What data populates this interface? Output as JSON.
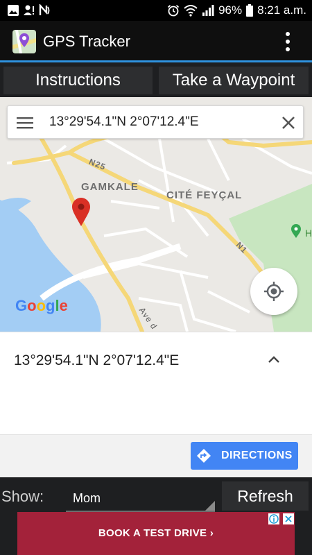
{
  "status_bar": {
    "battery": "96%",
    "time": "8:21 a.m.",
    "icons": [
      "image-icon",
      "account-alert-icon",
      "nfc-icon",
      "alarm-icon",
      "wifi-icon",
      "signal-icon",
      "battery-icon"
    ]
  },
  "app": {
    "title": "GPS Tracker",
    "icon": "map-pin-app-icon"
  },
  "buttons": {
    "instructions": "Instructions",
    "waypoint": "Take a Waypoint",
    "refresh": "Refresh"
  },
  "map": {
    "search_text": "13°29'54.1\"N 2°07'12.4\"E",
    "labels": {
      "gamkale": "GAMKALE",
      "cite": "CITÉ FEYÇAL",
      "n25": "N25",
      "n1": "N1",
      "ave": "Ave d",
      "poi": "H"
    },
    "logo": [
      "G",
      "o",
      "o",
      "g",
      "l",
      "e"
    ],
    "colors": {
      "water": "#a3cdf4",
      "park": "#c8e6c0",
      "road_major": "#f7d87c",
      "pin": "#d93025"
    }
  },
  "sheet": {
    "coords": "13°29'54.1\"N 2°07'12.4\"E",
    "directions": "DIRECTIONS"
  },
  "controls": {
    "show_label": "Show:",
    "show_value": "Mom"
  },
  "ad": {
    "text": "BOOK A TEST DRIVE  ›",
    "background": "#a3223a"
  },
  "colors": {
    "accent": "#2f93e0",
    "directions": "#4285f4"
  }
}
